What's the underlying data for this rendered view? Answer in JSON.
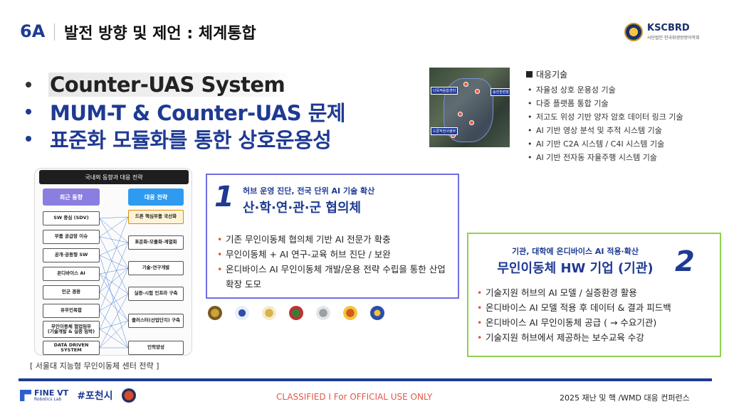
{
  "header": {
    "code": "6A",
    "title": "발전 방향 및 제언 : 체계통합",
    "logo": {
      "name": "KSCBRD",
      "subtitle": "사단법인 한국화생방방어학회"
    }
  },
  "bullets": [
    "Counter-UAS System",
    "MUM-T & Counter-UAS 문제",
    "표준화 모듈화를 통한 상호운용성"
  ],
  "map": {
    "tags": [
      "다목적융합센터",
      "송전훈련장",
      "드론작전사령부"
    ]
  },
  "tech": {
    "heading": "대응기술",
    "items": [
      "자율성 상호 운용성 기술",
      "다중 플랫폼 통합 기술",
      "저고도 위성 기반 양자 암호 데이터 링크 기술",
      "AI 기반 영상 분석 및 추적 시스템 기술",
      "AI 기반 C2A 시스템 / C4I 시스템 기술",
      "AI 기반 전자동 자율주행 시스템 기술"
    ]
  },
  "diagram": {
    "title": "국내외 동향과 대응 전략",
    "left_header": "최근 동향",
    "right_header": "대응 전략",
    "left_items": [
      "SW 중심 (SDV)",
      "부품 공급망 이슈",
      "공개·공동형 SW",
      "온디바이스 AI",
      "민군 겸용",
      "유무인복합",
      "무인이동체 협업임무\n(기술개발 & 실증 임박)",
      "DATA DRIVEN SYSTEM"
    ],
    "right_items": [
      "드론 핵심부품 국산화",
      "표준화-모듈화-계열화",
      "기술-연구개발",
      "실증-시험 인프라 구축",
      "클러스터(산업단지) 구축",
      "인력양성"
    ],
    "caption": "[ 서울대 지능형 무인이동체 센터 전략 ]"
  },
  "card1": {
    "number": "1",
    "subtitle": "허브 운영 진단,  전국 단위  AI 기술 확산",
    "title": "산·학·연·관·군 협의체",
    "items": [
      "기존 무인이동체 협의체 기반 AI 전문가 확충",
      "무인이동체 + AI 연구-교육 허브 진단 / 보완",
      "온디바이스 AI 무인이동체 개발/운용 전략 수립을 통한 산업 확장 도모"
    ]
  },
  "card2": {
    "number": "2",
    "subtitle": "기관, 대학에 온디바이스 AI 적용·확산",
    "title": "무인이동체 HW 기업 (기관)",
    "items": [
      "기술지원 허브의 AI 모델 / 실증환경 활용",
      "온디바이스 AI 모델 적용 후 데이터 & 결과 피드백",
      "온디바이스 AI 무인이동체 공급 ( → 수요기관)",
      "기술지원 허브에서 제공하는 보수교육 수강"
    ]
  },
  "footer": {
    "lab_name": "FINE VT",
    "lab_sub": "Robotics Lab",
    "city": "포천시",
    "city_hash": "#",
    "classified": "CLASSIFIED I For OFFICIAL USE ONLY",
    "conference": "2025 재난 및 핵 /WMD 대응 컨퍼런스"
  },
  "colors": {
    "primary": "#1f3a93",
    "accent_red": "#e05a4a",
    "card1_border": "#6f6fe0",
    "card2_border": "#8fd14f",
    "left_header": "#8a7ee0",
    "right_header": "#2f9bf0"
  }
}
